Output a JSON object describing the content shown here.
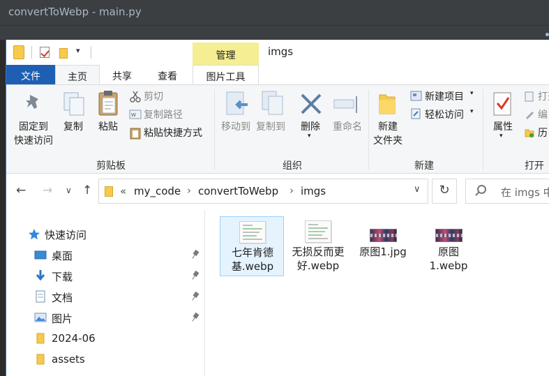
{
  "ide": {
    "title": "convertToWebp - main.py"
  },
  "explorer": {
    "window_title": "imgs",
    "contextual_tab_header": "管理",
    "tabs": {
      "file": "文件",
      "home": "主页",
      "share": "共享",
      "view": "查看",
      "picture_tools": "图片工具"
    },
    "ribbon": {
      "clipboard": {
        "pin_to_quick_access_line1": "固定到",
        "pin_to_quick_access_line2": "快速访问",
        "copy": "复制",
        "paste": "粘贴",
        "cut": "剪切",
        "copy_path": "复制路径",
        "paste_shortcut": "粘贴快捷方式",
        "group_label": "剪贴板"
      },
      "organize": {
        "move_to": "移动到",
        "copy_to": "复制到",
        "delete": "删除",
        "rename": "重命名",
        "group_label": "组织"
      },
      "new": {
        "new_folder_line1": "新建",
        "new_folder_line2": "文件夹",
        "new_item": "新建项目",
        "easy_access": "轻松访问",
        "group_label": "新建"
      },
      "open": {
        "properties": "属性",
        "open_partial": "打开",
        "edit_partial": "编",
        "history_partial": "历",
        "group_label": "打开"
      }
    },
    "address": {
      "overflow": "«",
      "crumbs": [
        "my_code",
        "convertToWebp",
        "imgs"
      ],
      "search_placeholder": "在 imgs 中"
    },
    "nav_pane": {
      "quick_access": "快速访问",
      "items": [
        {
          "label": "桌面",
          "icon": "desktop-icon",
          "pinned": true
        },
        {
          "label": "下载",
          "icon": "download-icon",
          "pinned": true
        },
        {
          "label": "文档",
          "icon": "document-icon",
          "pinned": true
        },
        {
          "label": "图片",
          "icon": "pictures-icon",
          "pinned": true
        },
        {
          "label": "2024-06",
          "icon": "folder-icon",
          "pinned": false
        },
        {
          "label": "assets",
          "icon": "folder-icon",
          "pinned": false
        }
      ]
    },
    "files": [
      {
        "name_line1": "七年肯德",
        "name_line2": "基.webp",
        "thumb": "document-thumbnail",
        "selected": true
      },
      {
        "name_line1": "无损反而更",
        "name_line2": "好.webp",
        "thumb": "document-thumbnail",
        "selected": false
      },
      {
        "name_line1": "原图1.jpg",
        "name_line2": "",
        "thumb": "image-thumbnail",
        "selected": false
      },
      {
        "name_line1": "原图",
        "name_line2": "1.webp",
        "thumb": "image-thumbnail",
        "selected": false
      }
    ],
    "colors": {
      "file_tab": "#1e5fb3",
      "manage_highlight": "#f5ee93",
      "selection_fill": "#e5f3ff",
      "selection_border": "#99d1ff",
      "folder_yellow": "#f7c94c",
      "quick_access_star": "#2f88e0"
    }
  }
}
